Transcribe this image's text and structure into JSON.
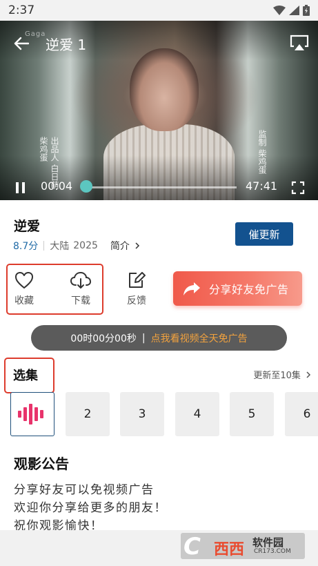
{
  "status_bar": {
    "time": "2:37"
  },
  "player": {
    "title": "逆爱 1",
    "watermark": "Gaga",
    "current_time": "00:04",
    "duration": "47:41",
    "progress": 0.0,
    "cast_left": "出品人 白日萌",
    "cast_left_2": "柴鸡蛋",
    "cast_right": "监制 柴鸡蛋",
    "accent_color": "#5cc6c0"
  },
  "info": {
    "title": "逆爱",
    "rating": "8.7分",
    "region": "大陆",
    "year": "2025",
    "intro_label": "简介",
    "urge_label": "催更新"
  },
  "actions": {
    "favorite_label": "收藏",
    "download_label": "下载",
    "feedback_label": "反馈",
    "share_label": "分享好友免广告"
  },
  "ad_banner": {
    "timer": "00时00分00秒",
    "divider": "|",
    "promo": "点我看视频全天免广告"
  },
  "episodes": {
    "title": "选集",
    "update_label": "更新至10集",
    "items": [
      "1",
      "2",
      "3",
      "4",
      "5",
      "6"
    ]
  },
  "notice": {
    "title": "观影公告",
    "lines": [
      "分享好友可以免视频广告",
      "欢迎你分享给更多的朋友！",
      "祝你观影愉快！"
    ]
  },
  "watermark_logo": {
    "main": "西西",
    "sub": "软件园",
    "domain": "CR173.COM"
  }
}
